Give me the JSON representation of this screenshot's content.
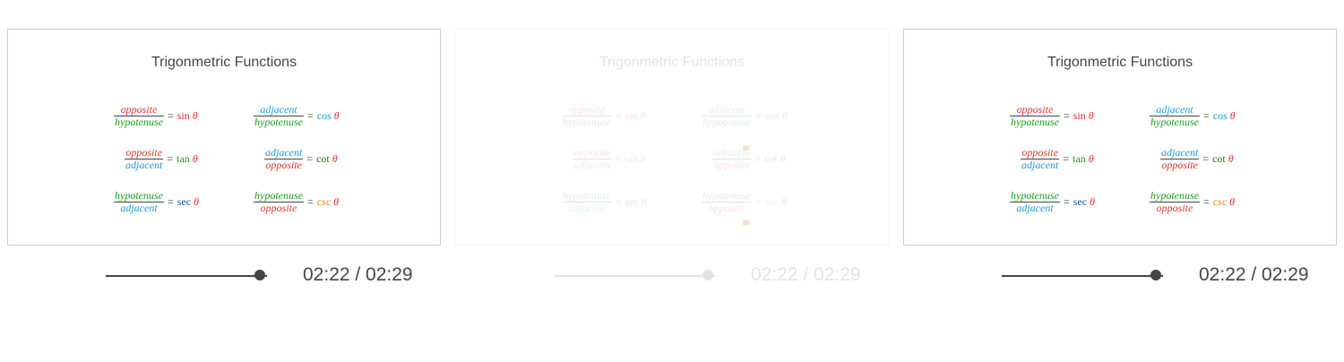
{
  "panels": [
    {
      "title": "Trigonmetric Functions",
      "formulas": [
        {
          "num": "opposite",
          "den": "hypotenuse",
          "func": "sin",
          "theta": "θ"
        },
        {
          "num": "adjacent",
          "den": "hypotenuse",
          "func": "cos",
          "theta": "θ"
        },
        {
          "num": "opposite",
          "den": "adjacent",
          "func": "tan",
          "theta": "θ"
        },
        {
          "num": "adjacent",
          "den": "opposite",
          "func": "cot",
          "theta": "θ"
        },
        {
          "num": "hypotenuse",
          "den": "adjacent",
          "func": "sec",
          "theta": "θ"
        },
        {
          "num": "hypotenuse",
          "den": "opposite",
          "func": "csc",
          "theta": "θ"
        }
      ],
      "time": "02:22 / 02:29",
      "progress": 0.953
    },
    {
      "title": "Trigonmetric Functions",
      "formulas": [
        {
          "num": "opposite",
          "den": "hypotenuse",
          "func": "sin",
          "theta": "θ"
        },
        {
          "num": "adjacent",
          "den": "hypotenuse",
          "func": "cos",
          "theta": "θ"
        },
        {
          "num": "opposite",
          "den": "adjacent",
          "func": "tan",
          "theta": "θ"
        },
        {
          "num": "adjacent",
          "den": "opposite",
          "func": "cot",
          "theta": "θ"
        },
        {
          "num": "hypotenuse",
          "den": "adjacent",
          "func": "sec",
          "theta": "θ"
        },
        {
          "num": "hypotenuse",
          "den": "opposite",
          "func": "csc",
          "theta": "θ"
        }
      ],
      "time": "02:22 / 02:29",
      "progress": 0.953
    },
    {
      "title": "Trigonmetric Functions",
      "formulas": [
        {
          "num": "opposite",
          "den": "hypotenuse",
          "func": "sin",
          "theta": "θ"
        },
        {
          "num": "adjacent",
          "den": "hypotenuse",
          "func": "cos",
          "theta": "θ"
        },
        {
          "num": "opposite",
          "den": "adjacent",
          "func": "tan",
          "theta": "θ"
        },
        {
          "num": "adjacent",
          "den": "opposite",
          "func": "cot",
          "theta": "θ"
        },
        {
          "num": "hypotenuse",
          "den": "adjacent",
          "func": "sec",
          "theta": "θ"
        },
        {
          "num": "hypotenuse",
          "den": "opposite",
          "func": "csc",
          "theta": "θ"
        }
      ],
      "time": "02:22 / 02:29",
      "progress": 0.953
    }
  ],
  "colors": {
    "opposite": "#e0312b",
    "hypotenuse": "#1a9e1a",
    "adjacent": "#1a99d6",
    "sin": "#e0312b",
    "cos": "#1a99d6",
    "tan": "#1a9e1a",
    "cot": "#1a7a1a",
    "sec": "#1a5aa6",
    "csc": "#f08c1a",
    "theta": "#e0312b",
    "control": "#444444"
  }
}
